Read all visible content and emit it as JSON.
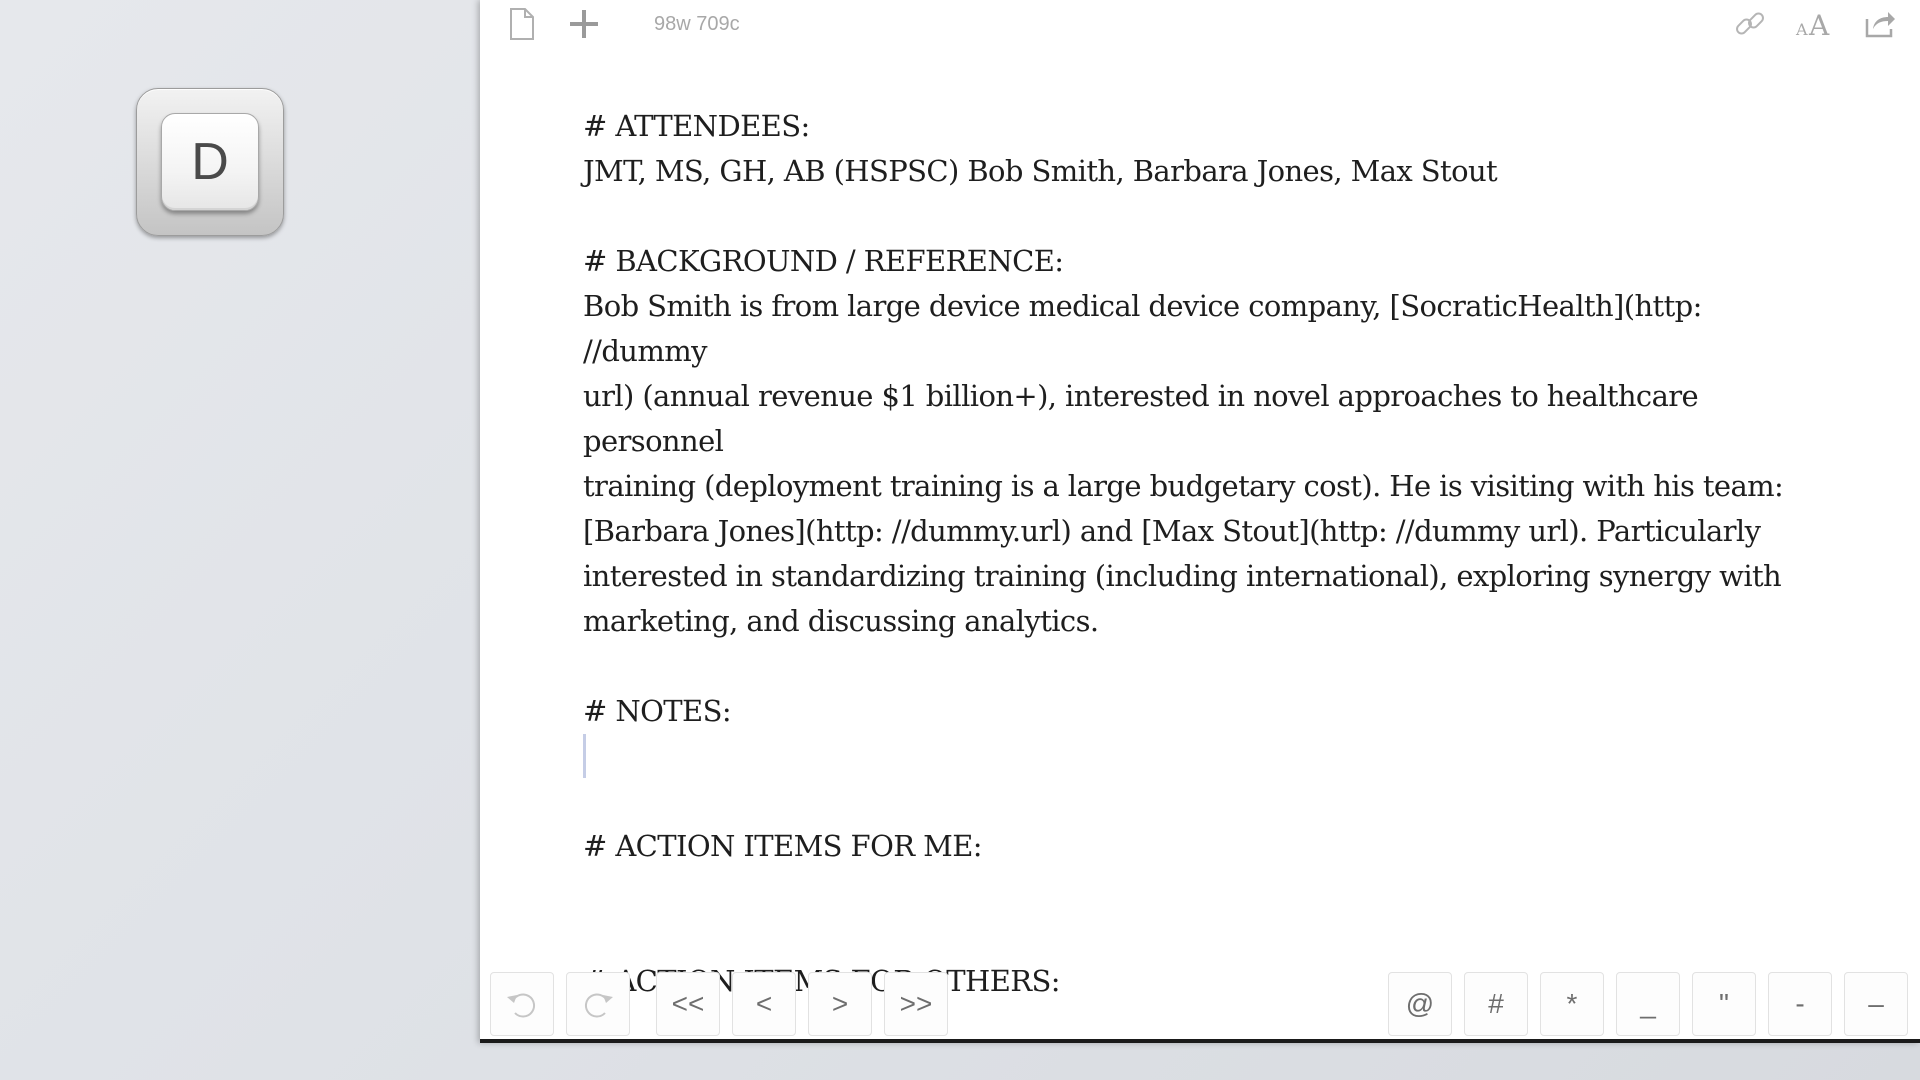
{
  "app_icon": {
    "letter": "D"
  },
  "toolbar": {
    "counter": "98w 709c",
    "icons": [
      "document-icon",
      "plus-icon",
      "link-icon",
      "text-size-icon",
      "share-icon"
    ]
  },
  "document": {
    "attendees_heading": "# ATTENDEES:",
    "attendees_line": "JMT, MS, GH, AB (HSPSC)  Bob Smith, Barbara Jones, Max Stout",
    "background_heading": "# BACKGROUND / REFERENCE:",
    "background_lines": [
      "Bob Smith is from large device medical device company, [SocraticHealth](http: //dummy",
      "url) (annual revenue $1 billion+), interested in novel approaches to healthcare personnel",
      "training (deployment training is a large budgetary cost). He is visiting with his team:",
      "[Barbara Jones](http: //dummy.url) and [Max Stout](http: //dummy url). Particularly",
      "interested in standardizing training (including international), exploring synergy with",
      "marketing, and discussing analytics."
    ],
    "notes_heading": "# NOTES:",
    "action_me_heading": "# ACTION ITEMS FOR ME:",
    "action_others_heading": "# ACTION ITEMS FOR OTHERS:"
  },
  "bottombar": {
    "undo_icon": "undo-icon",
    "redo_icon": "redo-icon",
    "nav": [
      "<<",
      "<",
      ">",
      ">>"
    ],
    "symbols": [
      "@",
      "#",
      "*",
      "_",
      "\"",
      "-",
      "–"
    ]
  },
  "colors": {
    "editor_bg": "#ffffff",
    "text": "#1e1e1e",
    "counter": "#a8a8a8",
    "cursor": "#c5cde6"
  }
}
